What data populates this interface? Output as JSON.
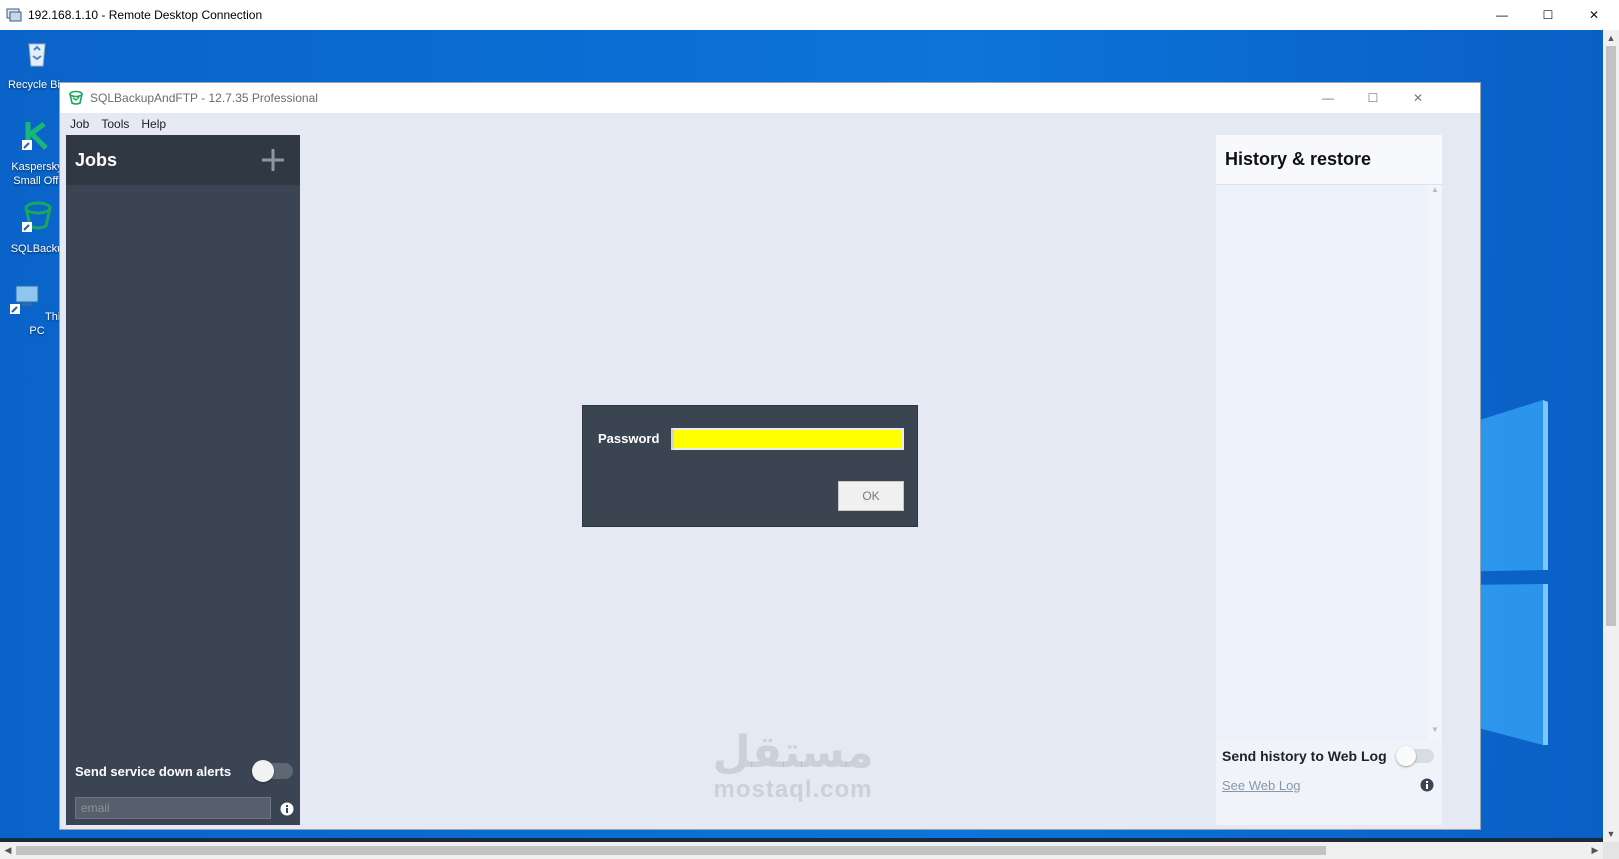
{
  "rdp": {
    "title": "192.168.1.10 - Remote Desktop Connection",
    "controls": {
      "minimize": "—",
      "maximize": "☐",
      "close": "✕"
    }
  },
  "desktop": {
    "icons": [
      {
        "label": "Recycle Bin",
        "icon": "recycle-bin-icon"
      },
      {
        "label": "Kaspersky Small Offi",
        "icon": "kaspersky-icon"
      },
      {
        "label": "SQLBacku",
        "icon": "sqlbackup-shortcut-icon"
      },
      {
        "label": "This PC",
        "icon": "this-pc-icon"
      }
    ]
  },
  "app": {
    "title": "SQLBackupAndFTP - 12.7.35 Professional",
    "menu": [
      "Job",
      "Tools",
      "Help"
    ],
    "controls": {
      "minimize": "—",
      "maximize": "☐",
      "close": "✕"
    }
  },
  "jobs_panel": {
    "title": "Jobs",
    "add_icon": "plus-icon",
    "alerts_label": "Send service down alerts",
    "alerts_enabled": false,
    "email_placeholder": "email",
    "email_value": ""
  },
  "history_panel": {
    "title": "History & restore",
    "weblog_label": "Send history to Web Log",
    "weblog_enabled": false,
    "see_weblog": "See Web Log"
  },
  "password_dialog": {
    "label": "Password",
    "value": "",
    "ok_label": "OK"
  },
  "watermark": {
    "arabic": "مستقل",
    "latin": "mostaql.com"
  },
  "colors": {
    "desktop_blue": "#0c74da",
    "jobs_panel_bg": "#3a4452",
    "dialog_bg": "#3b4552",
    "password_highlight": "#ffff00"
  }
}
